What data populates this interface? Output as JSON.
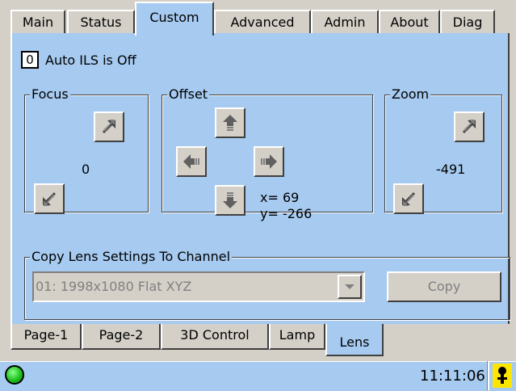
{
  "top_tabs": [
    {
      "label": "Main"
    },
    {
      "label": "Status"
    },
    {
      "label": "Custom"
    },
    {
      "label": "Advanced"
    },
    {
      "label": "Admin"
    },
    {
      "label": "About"
    },
    {
      "label": "Diag"
    }
  ],
  "ils": {
    "value": "0",
    "label": "Auto ILS is Off"
  },
  "focus": {
    "title": "Focus",
    "value": "0"
  },
  "offset": {
    "title": "Offset",
    "x_label": "x= 69",
    "y_label": "y= -266"
  },
  "zoom": {
    "title": "Zoom",
    "value": "-491"
  },
  "copy_lens": {
    "title": "Copy Lens Settings To Channel",
    "selected_channel": "01: 1998x1080  Flat XYZ",
    "copy_label": "Copy"
  },
  "bottom_tabs": [
    {
      "label": "Page-1"
    },
    {
      "label": "Page-2"
    },
    {
      "label": "3D Control"
    },
    {
      "label": "Lamp"
    },
    {
      "label": "Lens"
    }
  ],
  "status": {
    "time": "11:11:06",
    "indicator_color": "#22c322"
  },
  "colors": {
    "panel_blue": "#a6caf0",
    "chrome_gray": "#d4d0c8"
  },
  "icons": {
    "zoom_in": "arrow-up-right-icon",
    "zoom_out": "arrow-down-left-icon",
    "offset_up": "arrow-up-icon",
    "offset_down": "arrow-down-icon",
    "offset_left": "arrow-left-icon",
    "offset_right": "arrow-right-icon"
  }
}
